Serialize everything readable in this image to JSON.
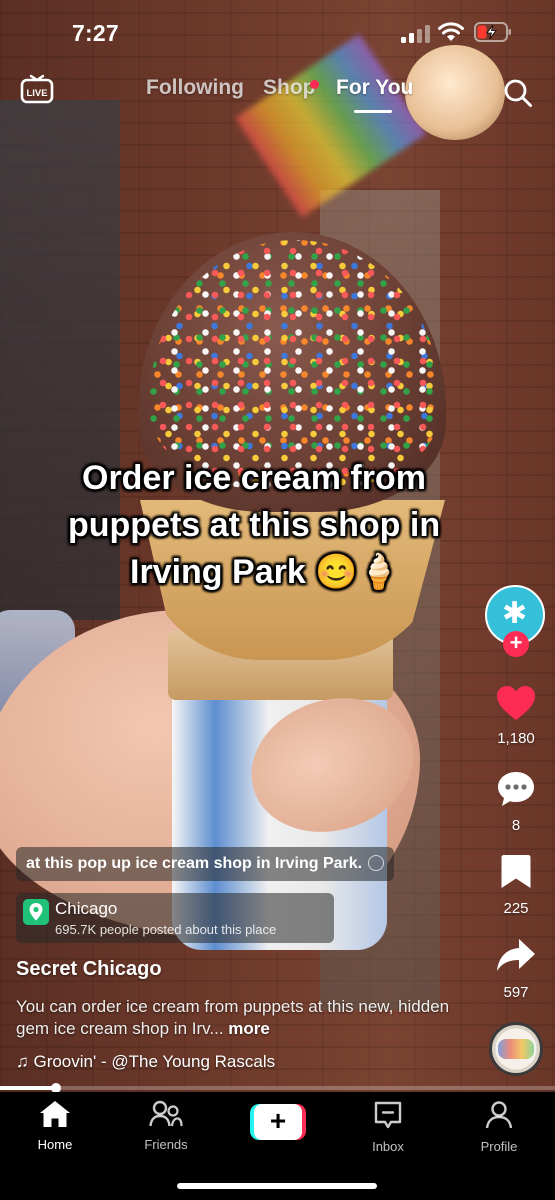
{
  "status_bar": {
    "time": "7:27"
  },
  "top_nav": {
    "live_label": "LIVE",
    "tabs": [
      {
        "label": "Following"
      },
      {
        "label": "Shop"
      },
      {
        "label": "For You"
      }
    ],
    "active_tab": "For You"
  },
  "video": {
    "overlay_caption": {
      "line1": "Order ice cream from",
      "line2": "puppets at this shop in",
      "line3": "Irving Park 😊🍦"
    },
    "search_suggestion": "at this pop up ice cream shop in Irving Park.",
    "place": {
      "name": "Chicago",
      "subtitle": "695.7K people posted about this place"
    },
    "author": "Secret Chicago",
    "description": "You can order ice cream from puppets at this new, hidden gem ice cream shop in Irv...",
    "description_more": "more",
    "sound": "♫ Groovin' - @The Young Rascals",
    "progress_fraction": 0.1
  },
  "actions": {
    "likes": "1,180",
    "comments": "8",
    "saves": "225",
    "shares": "597"
  },
  "tab_bar": {
    "home": "Home",
    "friends": "Friends",
    "inbox": "Inbox",
    "profile": "Profile"
  },
  "colors": {
    "accent_red": "#fe2c55",
    "accent_cyan": "#25f4ee",
    "place_green": "#20c178",
    "avatar_teal": "#35c0d9"
  }
}
